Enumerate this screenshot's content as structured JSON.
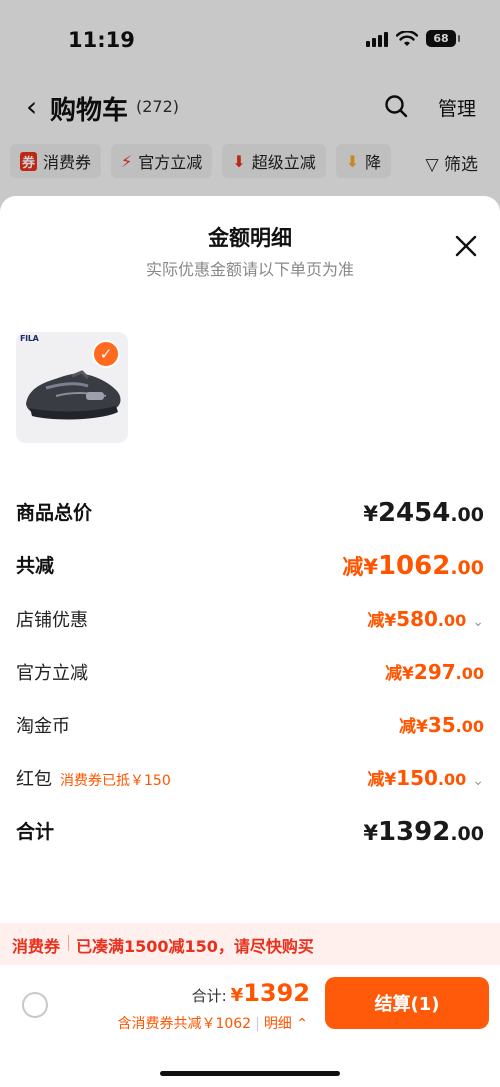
{
  "status": {
    "time": "11:19",
    "battery": "68"
  },
  "nav": {
    "title": "购物车",
    "count": "(272)",
    "manage": "管理"
  },
  "filters": [
    {
      "icon": "coupon-icon",
      "glyph": "券",
      "label": "消费券"
    },
    {
      "icon": "lightning-icon",
      "glyph": "⚡",
      "label": "官方立减"
    },
    {
      "icon": "down-arrow-icon",
      "glyph": "⬇",
      "label": "超级立减"
    },
    {
      "icon": "price-drop-icon",
      "glyph": "⬇",
      "label": "降"
    }
  ],
  "filter_button": "筛选",
  "sheet": {
    "title": "金额明细",
    "subtitle": "实际优惠金额请以下单页为准",
    "product_brand": "FILA"
  },
  "rows": {
    "subtotal": {
      "label": "商品总价",
      "prefix": "¥",
      "int": "2454",
      "dec": ".00"
    },
    "total_discount": {
      "label": "共减",
      "prefix": "减¥",
      "int": "1062",
      "dec": ".00"
    },
    "store": {
      "label": "店铺优惠",
      "prefix": "减¥",
      "int": "580",
      "dec": ".00"
    },
    "official": {
      "label": "官方立减",
      "prefix": "减¥",
      "int": "297",
      "dec": ".00"
    },
    "coins": {
      "label": "淘金币",
      "prefix": "减¥",
      "int": "35",
      "dec": ".00"
    },
    "redpacket": {
      "label": "红包",
      "sublabel": "消费券已抵￥150",
      "prefix": "减¥",
      "int": "150",
      "dec": ".00"
    },
    "total": {
      "label": "合计",
      "prefix": "¥",
      "int": "1392",
      "dec": ".00"
    }
  },
  "promo": {
    "tag": "消费券",
    "text": "已凑满1500减150，请尽快购买"
  },
  "footer": {
    "total_label": "合计:",
    "total_prefix": "¥",
    "total_value": "1392",
    "discount_text": "含消费券共减￥1062",
    "detail_label": "明细",
    "checkout_label": "结算(1)"
  },
  "colors": {
    "accent": "#ff5500",
    "promo_red": "#e8301c"
  }
}
